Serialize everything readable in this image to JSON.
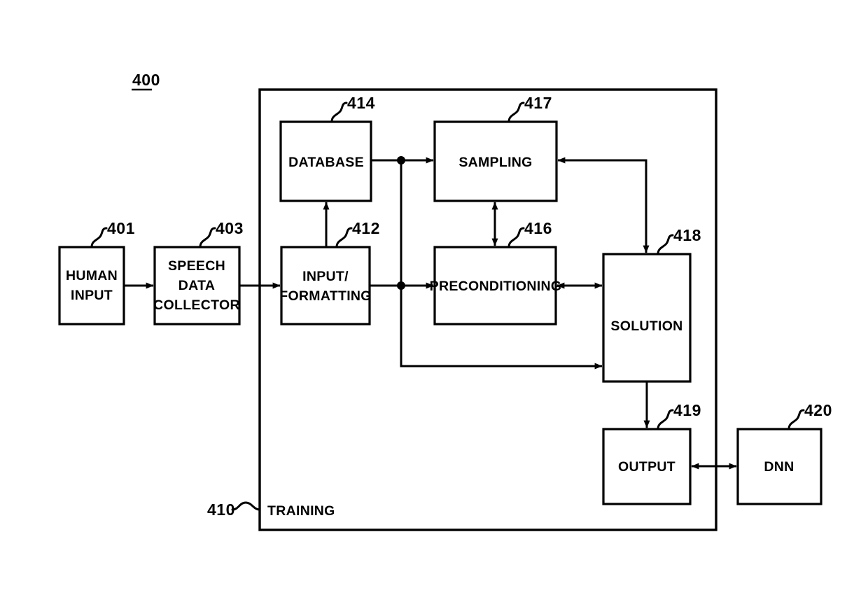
{
  "figure": {
    "number": "400",
    "container_label": "TRAINING",
    "container_ref": "410"
  },
  "blocks": [
    {
      "id": "human-input",
      "label_lines": [
        "HUMAN",
        "INPUT"
      ],
      "ref": "401"
    },
    {
      "id": "speech-collector",
      "label_lines": [
        "SPEECH",
        "DATA",
        "COLLECTOR"
      ],
      "ref": "403"
    },
    {
      "id": "input-formatting",
      "label_lines": [
        "INPUT/",
        "FORMATTING"
      ],
      "ref": "412"
    },
    {
      "id": "database",
      "label_lines": [
        "DATABASE"
      ],
      "ref": "414"
    },
    {
      "id": "preconditioning",
      "label_lines": [
        "PRECONDITIONING"
      ],
      "ref": "416"
    },
    {
      "id": "sampling",
      "label_lines": [
        "SAMPLING"
      ],
      "ref": "417"
    },
    {
      "id": "solution",
      "label_lines": [
        "SOLUTION"
      ],
      "ref": "418"
    },
    {
      "id": "output",
      "label_lines": [
        "OUTPUT"
      ],
      "ref": "419"
    },
    {
      "id": "dnn",
      "label_lines": [
        "DNN"
      ],
      "ref": "420"
    }
  ],
  "labels": {
    "human_input_l1": "HUMAN",
    "human_input_l2": "INPUT",
    "speech_l1": "SPEECH",
    "speech_l2": "DATA",
    "speech_l3": "COLLECTOR",
    "input_fmt_l1": "INPUT/",
    "input_fmt_l2": "FORMATTING",
    "database": "DATABASE",
    "preconditioning": "PRECONDITIONING",
    "sampling": "SAMPLING",
    "solution": "SOLUTION",
    "output": "OUTPUT",
    "dnn": "DNN",
    "training": "TRAINING"
  },
  "refs": {
    "figure": "400",
    "human_input": "401",
    "speech_collector": "403",
    "training": "410",
    "input_formatting": "412",
    "database": "414",
    "preconditioning": "416",
    "sampling": "417",
    "solution": "418",
    "output": "419",
    "dnn": "420"
  },
  "colors": {
    "ink": "#000000",
    "paper": "#ffffff"
  },
  "connections": [
    {
      "from": "human-input",
      "to": "speech-collector",
      "direction": "one-way"
    },
    {
      "from": "speech-collector",
      "to": "input-formatting",
      "direction": "one-way"
    },
    {
      "from": "input-formatting",
      "to": "database",
      "direction": "one-way"
    },
    {
      "from": "database",
      "to": "sampling",
      "direction": "one-way"
    },
    {
      "from": "input-formatting",
      "to": "preconditioning",
      "direction": "one-way"
    },
    {
      "from": "input-formatting",
      "to": "solution",
      "direction": "one-way"
    },
    {
      "from": "sampling",
      "to": "preconditioning",
      "direction": "bidirectional"
    },
    {
      "from": "preconditioning",
      "to": "solution",
      "direction": "bidirectional"
    },
    {
      "from": "solution",
      "to": "sampling",
      "direction": "one-way"
    },
    {
      "from": "solution",
      "to": "output",
      "direction": "one-way"
    },
    {
      "from": "output",
      "to": "dnn",
      "direction": "bidirectional"
    }
  ]
}
